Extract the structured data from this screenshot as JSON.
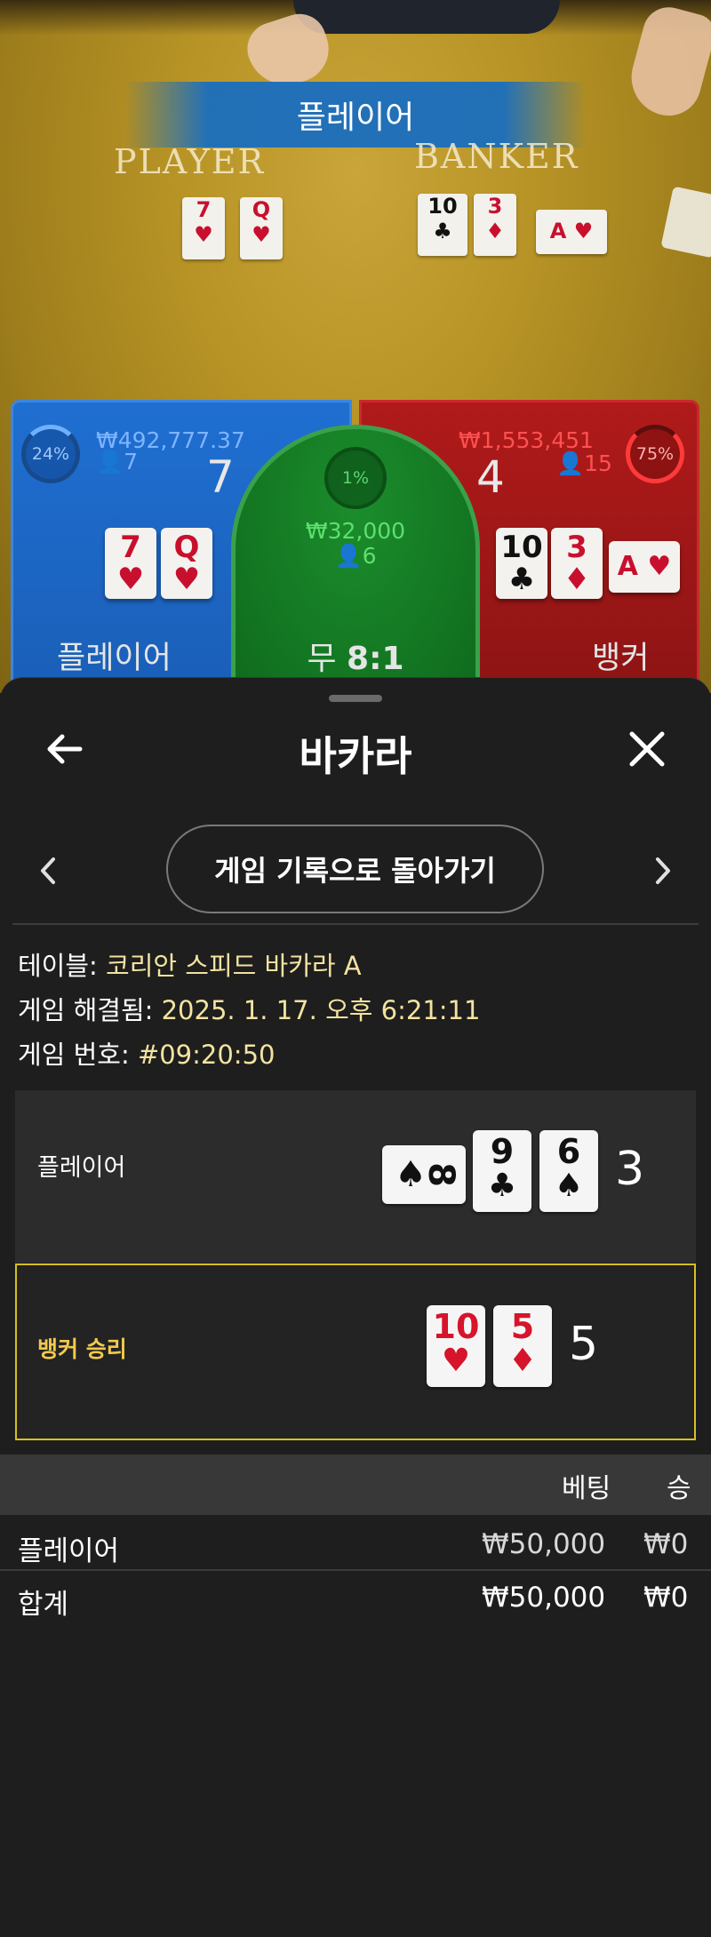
{
  "video": {
    "banner": "플레이어",
    "player_label": "PLAYER",
    "banker_label": "BANKER",
    "player_cards": [
      {
        "rank": "7",
        "suit": "♥",
        "color": "red"
      },
      {
        "rank": "Q",
        "suit": "♥",
        "color": "red"
      }
    ],
    "banker_cards": [
      {
        "rank": "10",
        "suit": "♣",
        "color": "black"
      },
      {
        "rank": "3",
        "suit": "♦",
        "color": "red"
      },
      {
        "rank": "A",
        "suit": "♥",
        "color": "red"
      }
    ]
  },
  "bet_panels": {
    "player": {
      "percent": "24%",
      "amount": "₩492,777.37",
      "count": "7",
      "score": "7",
      "label": "플레이어",
      "cards": [
        {
          "rank": "7",
          "suit": "♥",
          "color": "red"
        },
        {
          "rank": "Q",
          "suit": "♥",
          "color": "red"
        }
      ]
    },
    "banker": {
      "percent": "75%",
      "amount": "₩1,553,451",
      "count": "15",
      "score": "4",
      "label": "뱅커",
      "cards": [
        {
          "rank": "10",
          "suit": "♣",
          "color": "black"
        },
        {
          "rank": "3",
          "suit": "♦",
          "color": "red"
        },
        {
          "rank": "A",
          "suit": "♥",
          "color": "red"
        }
      ]
    },
    "tie": {
      "percent": "1%",
      "amount": "₩32,000",
      "count": "6",
      "label": "무",
      "payout": "8:1"
    }
  },
  "sheet": {
    "title": "바카라",
    "history_button": "게임 기록으로 돌아가기",
    "info": {
      "table_key": "테이블:",
      "table_value": "코리안 스피드 바카라 A",
      "resolved_key": "게임 해결됨:",
      "resolved_value": "2025. 1. 17. 오후 6:21:11",
      "number_key": "게임 번호:",
      "number_value": "#09:20:50"
    },
    "player_result": {
      "label": "플레이어",
      "total": "3",
      "cards": [
        {
          "rank": "8",
          "suit": "♠",
          "color": "black",
          "sideways": true
        },
        {
          "rank": "9",
          "suit": "♣",
          "color": "black"
        },
        {
          "rank": "6",
          "suit": "♠",
          "color": "black"
        }
      ]
    },
    "banker_result": {
      "label": "뱅커 승리",
      "total": "5",
      "cards": [
        {
          "rank": "10",
          "suit": "♥",
          "color": "red"
        },
        {
          "rank": "5",
          "suit": "♦",
          "color": "red"
        }
      ]
    },
    "bets_table": {
      "headers": [
        "베팅",
        "승"
      ],
      "rows": [
        {
          "name": "플레이어",
          "bet": "₩50,000",
          "win": "₩0"
        },
        {
          "name": "합계",
          "bet": "₩50,000",
          "win": "₩0"
        }
      ]
    }
  },
  "colors": {
    "player_blue": "#1f6fd1",
    "banker_red": "#b01a1a",
    "tie_green": "#1b8d2c",
    "win_highlight": "#d6c021",
    "info_value": "#f3e3a0"
  }
}
